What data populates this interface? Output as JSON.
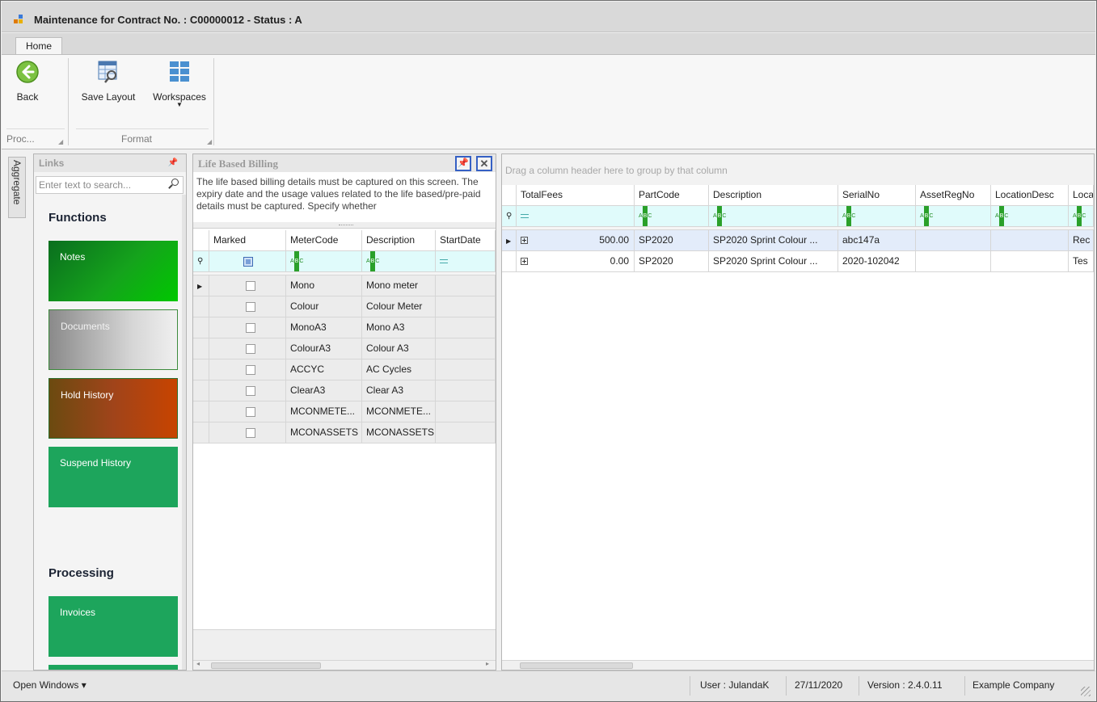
{
  "window": {
    "title": "Maintenance for Contract No. : C00000012 - Status : A"
  },
  "ribbon": {
    "tabs": [
      "Home"
    ],
    "buttons": {
      "back": "Back",
      "save_layout": "Save Layout",
      "workspaces": "Workspaces"
    },
    "groups": {
      "process": "Proc...",
      "format": "Format"
    }
  },
  "side_tab": "Aggregate",
  "links_panel": {
    "title": "Links",
    "search_placeholder": "Enter text to search...",
    "functions_heading": "Functions",
    "functions": [
      "Notes",
      "Documents",
      "Hold History",
      "Suspend History"
    ],
    "processing_heading": "Processing",
    "processing": [
      "Invoices"
    ]
  },
  "lbb_panel": {
    "title": "Life Based Billing",
    "description": "The life based billing details must be captured on this screen. The expiry date and the usage values related to the life based/pre-paid details must be captured. Specify whether",
    "columns": [
      "Marked",
      "MeterCode",
      "Description",
      "StartDate"
    ],
    "rows": [
      {
        "meter": "Mono",
        "desc": "Mono meter"
      },
      {
        "meter": "Colour",
        "desc": "Colour Meter"
      },
      {
        "meter": "MonoA3",
        "desc": "Mono A3"
      },
      {
        "meter": "ColourA3",
        "desc": "Colour A3"
      },
      {
        "meter": "ACCYC",
        "desc": "AC Cycles"
      },
      {
        "meter": "ClearA3",
        "desc": "Clear A3"
      },
      {
        "meter": "MCONMETE...",
        "desc": "MCONMETE..."
      },
      {
        "meter": "MCONASSETS",
        "desc": "MCONASSETS"
      }
    ]
  },
  "main_grid": {
    "group_hint": "Drag a column header here to group by that column",
    "columns": [
      "TotalFees",
      "PartCode",
      "Description",
      "SerialNo",
      "AssetRegNo",
      "LocationDesc",
      "Loca"
    ],
    "rows": [
      {
        "fees": "500.00",
        "part": "SP2020",
        "desc": "SP2020 Sprint Colour ...",
        "serial": "abc147a",
        "asset": "",
        "loc": "",
        "loca": "Rec"
      },
      {
        "fees": "0.00",
        "part": "SP2020",
        "desc": "SP2020 Sprint Colour ...",
        "serial": "2020-102042",
        "asset": "",
        "loc": "",
        "loca": "Tes"
      }
    ]
  },
  "statusbar": {
    "open_windows": "Open Windows ▾",
    "user": "User : JulandaK",
    "date": "27/11/2020",
    "version": "Version : 2.4.0.11",
    "company": "Example Company"
  },
  "colors": {
    "tile_green": "#1da55c",
    "filter_row": "#e0fbfb",
    "selected_row": "#e3ecfa",
    "highlight_border": "#3560c4"
  }
}
